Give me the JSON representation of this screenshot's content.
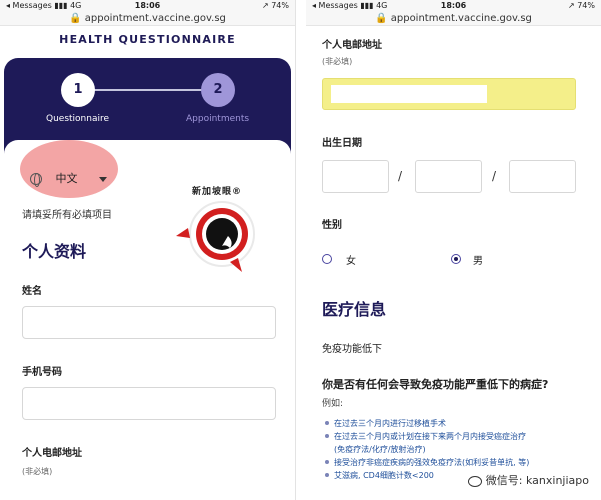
{
  "status_bar": {
    "carrier": "◂ Messages ▮▮▮ 4G",
    "time": "18:06",
    "battery": "↗ 74%",
    "url": "🔒 appointment.vaccine.gov.sg"
  },
  "left_screen": {
    "title": "HEALTH QUESTIONNAIRE",
    "steps": [
      {
        "number": "1",
        "label": "Questionnaire",
        "active": true
      },
      {
        "number": "2",
        "label": "Appointments",
        "active": false
      }
    ],
    "language": {
      "icon": "globe-icon",
      "value": "中文",
      "caret": "caret-down-icon"
    },
    "required_note": "请填妥所有必填项目",
    "section_title": "个人资料",
    "fields": [
      {
        "label": "姓名",
        "value": ""
      },
      {
        "label": "手机号码",
        "value": ""
      }
    ],
    "email_label": "个人电邮地址",
    "email_optional": "(非必填)",
    "logo": {
      "text": "新加坡眼",
      "registered": "®"
    }
  },
  "right_screen": {
    "email_label": "个人电邮地址",
    "email_optional": "(非必填)",
    "email_value": "",
    "dob_label": "出生日期",
    "dob_separators": [
      "/",
      "/"
    ],
    "gender_label": "性别",
    "gender_options": [
      {
        "label": "女",
        "checked": false
      },
      {
        "label": "男",
        "checked": true
      }
    ],
    "medical_title": "医疗信息",
    "immunocompromised_label": "免疫功能低下",
    "question": "你是否有任何会导致免疫功能严重低下的病症?",
    "examples_label": "例如:",
    "examples": [
      {
        "text": "在过去三个月内进行过移植手术",
        "bullet": true
      },
      {
        "text": "在过去三个月内或计划在接下来两个月内接受癌症治疗",
        "bullet": true
      },
      {
        "text": "(免疫疗法/化疗/放射治疗)",
        "bullet": false
      },
      {
        "text": "接受治疗非癌症疾病的强效免疫疗法(如利妥昔单抗, 等)",
        "bullet": true
      },
      {
        "text": "艾滋病, CD4细胞计数<200",
        "bullet": true
      }
    ],
    "watermark": "微信号: kanxinjiapo"
  },
  "colors": {
    "navy": "#1e1a58",
    "step_inactive": "#9f96d9",
    "highlight_yellow": "#f4ef8a",
    "annotation_red": "#f29b9b",
    "link_blue": "#1e4e9a"
  }
}
